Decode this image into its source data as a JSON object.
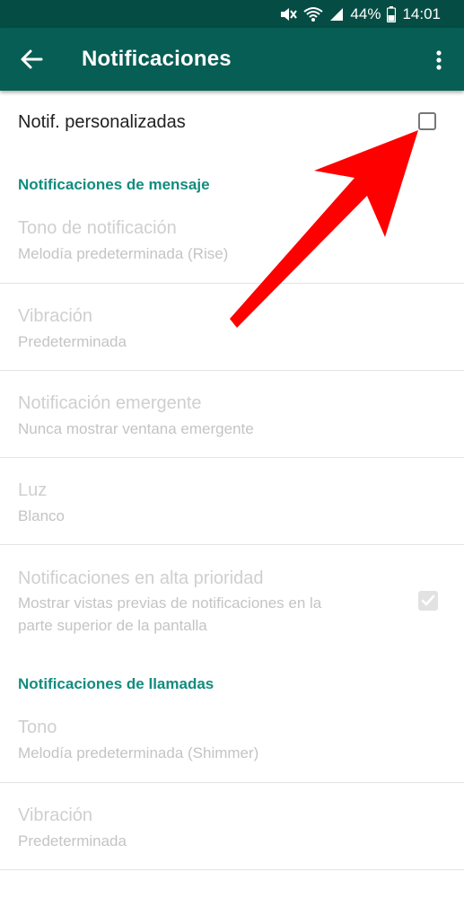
{
  "status_bar": {
    "icons": [
      "mute-icon",
      "wifi-icon",
      "signal-icon",
      "battery-icon"
    ],
    "battery": "44%",
    "time": "14:01"
  },
  "app_bar": {
    "title": "Notificaciones",
    "back_icon": "arrow-back-icon",
    "menu_icon": "more-vert-icon",
    "color": "#075e54"
  },
  "custom_notifications": {
    "label": "Notif. personalizadas",
    "checked": false
  },
  "sections": [
    {
      "header": "Notificaciones de mensaje",
      "items": [
        {
          "title": "Tono de notificación",
          "subtitle": "Melodía predeterminada (Rise)"
        },
        {
          "title": "Vibración",
          "subtitle": "Predeterminada"
        },
        {
          "title": "Notificación emergente",
          "subtitle": "Nunca mostrar ventana emergente"
        },
        {
          "title": "Luz",
          "subtitle": "Blanco"
        },
        {
          "title": "Notificaciones en alta prioridad",
          "subtitle_line1": "Mostrar vistas previas de notificaciones en la",
          "subtitle_line2": "parte superior de la pantalla",
          "checked": true
        }
      ]
    },
    {
      "header": "Notificaciones de llamadas",
      "items": [
        {
          "title": "Tono",
          "subtitle": "Melodía predeterminada (Shimmer)"
        },
        {
          "title": "Vibración",
          "subtitle": "Predeterminada"
        }
      ]
    }
  ],
  "colors": {
    "accent": "#128c7e",
    "annotation_arrow": "#ff0000",
    "disabled_text": "#cfcfcf"
  }
}
